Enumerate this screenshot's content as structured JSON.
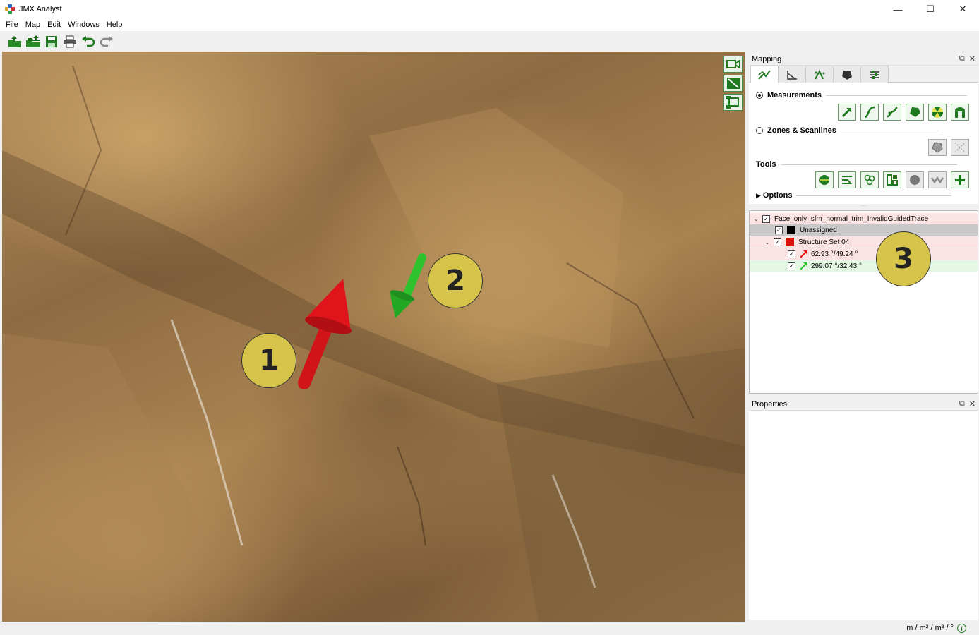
{
  "window": {
    "title": "JMX Analyst",
    "controls": {
      "minimize": "—",
      "maximize": "☐",
      "close": "✕"
    }
  },
  "menu": {
    "items": [
      "File",
      "Map",
      "Edit",
      "Windows",
      "Help"
    ]
  },
  "toolbar": {
    "buttons": [
      "open-folder-icon",
      "open-multiple-icon",
      "save-icon",
      "print-icon",
      "undo-icon",
      "redo-icon"
    ]
  },
  "viewport": {
    "callouts": [
      "1",
      "2",
      "3"
    ],
    "arrow_colors": {
      "red": "#e0151b",
      "green": "#2fc22f"
    }
  },
  "mapping_panel": {
    "title": "Mapping",
    "sections": {
      "measurements": "Measurements",
      "zones": "Zones & Scanlines",
      "tools": "Tools",
      "options": "Options"
    }
  },
  "tree": {
    "root": "Face_only_sfm_normal_trim_InvalidGuidedTrace",
    "unassigned": "Unassigned",
    "structure_set": "Structure Set 04",
    "measure_1": "62.93 °/49.24 °",
    "measure_2": "299.07 °/32.43 °",
    "grip": "....."
  },
  "properties_panel": {
    "title": "Properties"
  },
  "status": {
    "units": "m / m² / m³ / °",
    "info": "i"
  },
  "colors": {
    "accent_green": "#2a8a2a",
    "set_red": "#e01010",
    "row_pink": "#fbe3e3",
    "row_green": "#e3f7e3",
    "row_gray": "#c8c8c8",
    "callout": "#d6c34a"
  }
}
